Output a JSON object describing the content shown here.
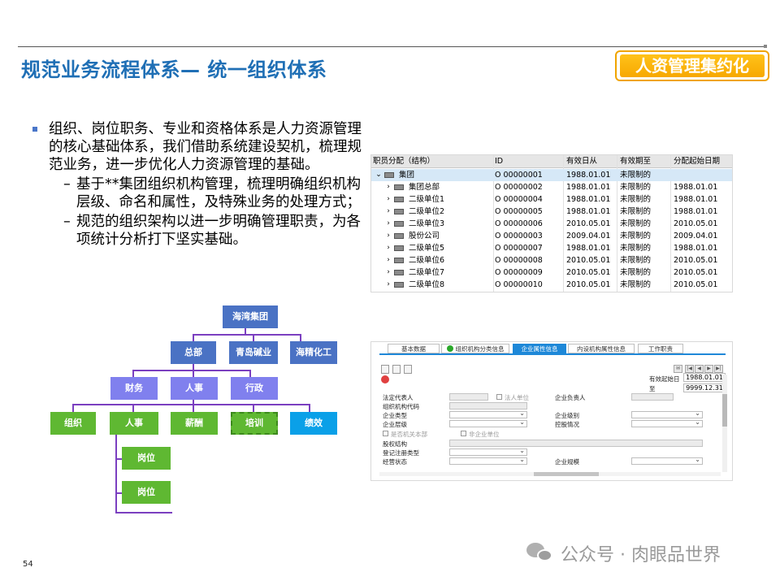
{
  "header": {
    "title": "规范业务流程体系— 统一组织体系",
    "brand": "人资管理集约化"
  },
  "content": {
    "bullet": "组织、岗位职务、专业和资格体系是人力资源管理的核心基础体系，我们借助系统建设契机，梳理规范业务，进一步优化人力资源管理的基础。",
    "sub_items": [
      "基于**集团组织机构管理，梳理明确组织机构层级、命名和属性，及特殊业务的处理方式；",
      "规范的组织架构以进一步明确管理职责，为各项统计分析打下坚实基础。"
    ],
    "dash": "–"
  },
  "org_chart": {
    "root": "海湾集团",
    "level1": [
      "总部",
      "青岛碱业",
      "海精化工"
    ],
    "level2": [
      "财务",
      "人事",
      "行政"
    ],
    "level3": [
      "组织",
      "人事",
      "薪酬",
      "培训",
      "绩效"
    ],
    "level4": [
      "岗位",
      "岗位"
    ]
  },
  "org_table": {
    "columns": [
      "职员分配（结构）",
      "ID",
      "有效日从",
      "有效期至",
      "分配起始日期"
    ],
    "rows": [
      {
        "name": "集团",
        "id": "O  00000001",
        "from": "1988.01.01",
        "to": "未限制的",
        "start": "",
        "selected": true
      },
      {
        "name": "集团总部",
        "id": "O  00000002",
        "from": "1988.01.01",
        "to": "未限制的",
        "start": "1988.01.01"
      },
      {
        "name": "二级单位1",
        "id": "O  00000004",
        "from": "1988.01.01",
        "to": "未限制的",
        "start": "1988.01.01"
      },
      {
        "name": "二级单位2",
        "id": "O  00000005",
        "from": "1988.01.01",
        "to": "未限制的",
        "start": "1988.01.01"
      },
      {
        "name": "二级单位3",
        "id": "O  00000006",
        "from": "2010.05.01",
        "to": "未限制的",
        "start": "2010.05.01"
      },
      {
        "name": "股份公司",
        "id": "O  00000003",
        "from": "2009.04.01",
        "to": "未限制的",
        "start": "2009.04.01"
      },
      {
        "name": "二级单位5",
        "id": "O  00000007",
        "from": "1988.01.01",
        "to": "未限制的",
        "start": "1988.01.01"
      },
      {
        "name": "二级单位6",
        "id": "O  00000008",
        "from": "2010.05.01",
        "to": "未限制的",
        "start": "2010.05.01"
      },
      {
        "name": "二级单位7",
        "id": "O  00000009",
        "from": "2010.05.01",
        "to": "未限制的",
        "start": "2010.05.01"
      },
      {
        "name": "二级单位8",
        "id": "O  00000010",
        "from": "2010.05.01",
        "to": "未限制的",
        "start": "2010.05.01"
      }
    ]
  },
  "form": {
    "tabs": [
      "基本数据",
      "组织机构分类信息",
      "企业属性信息",
      "内设机构属性信息",
      "工作职责"
    ],
    "active_tab": "企业属性信息",
    "valid_from_label": "有效起始日",
    "valid_from": "1988.01.01",
    "valid_to_label": "至",
    "valid_to": "9999.12.31",
    "labels": {
      "legal_rep": "法定代表人",
      "legal_unit": "法人单位",
      "enterprise_head": "企业负责人",
      "org_code": "组织机构代码",
      "enterprise_type": "企业类型",
      "enterprise_grade": "企业级别",
      "enterprise_level": "企业层级",
      "holding": "控股情况",
      "is_agency": "是否机关本部",
      "non_enterprise": "非企业单位",
      "equity": "股权结构",
      "reg_type": "登记注册类型",
      "op_status": "经营状态",
      "scale": "企业规模"
    }
  },
  "footer": {
    "page_number": "54",
    "watermark": "公众号 · 肉眼品世界"
  },
  "colors": {
    "title": "#1f6fb5",
    "brand_bg": "#f7a800",
    "node_blue": "#4a72c4",
    "node_purple": "#8080ee",
    "node_green": "#5fb832",
    "node_cyan": "#0aa0e8",
    "connector": "#7b3fc0",
    "tab_active": "#1e88d8"
  }
}
